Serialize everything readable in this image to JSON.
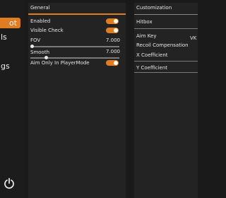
{
  "sidebar": {
    "items": [
      {
        "label": "ot",
        "active": true
      },
      {
        "label": "ls",
        "active": false
      },
      {
        "label": "gs",
        "active": false
      }
    ]
  },
  "general": {
    "title": "General",
    "enabled_label": "Enabled",
    "enabled_on": true,
    "visible_check_label": "Visible Check",
    "visible_check_on": true,
    "fov_label": "FOV",
    "fov_value": "7.000",
    "fov_level": 0.02,
    "smooth_label": "Smooth",
    "smooth_value": "7.000",
    "smooth_level": 0.18,
    "aim_only_label": "Aim Only In PlayerMode",
    "aim_only_on": true
  },
  "customization": {
    "title": "Customization",
    "hitbox_label": "Hitbox",
    "aim_key_label": "Aim Key",
    "aim_key_value": "VK",
    "recoil_label": "Recoil Compensation",
    "x_coeff_label": "X Coefficient",
    "y_coeff_label": "Y Coefficient"
  },
  "colors": {
    "accent": "#e07d22",
    "background": "#1a1a1a",
    "panel": "#232323"
  }
}
